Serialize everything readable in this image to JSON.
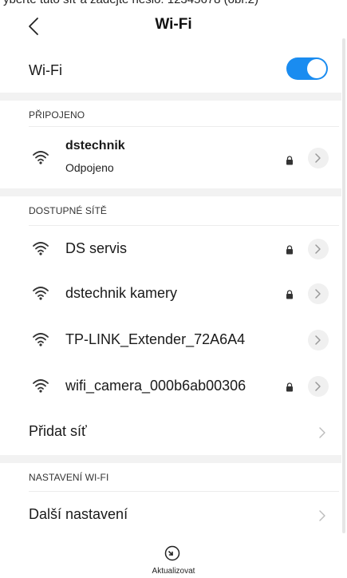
{
  "caption": "yberte tuto síť a zadejte heslo: 12345678 (obr.2)",
  "header": {
    "title": "Wi-Fi",
    "back_icon": "chevron-left-icon"
  },
  "wifi_toggle": {
    "label": "Wi-Fi",
    "on": true,
    "accent": "#1a8cf0"
  },
  "connected": {
    "header": "PŘIPOJENO",
    "network": {
      "name": "dstechnik",
      "status": "Odpojeno",
      "secured": true
    }
  },
  "available": {
    "header": "DOSTUPNÉ SÍTĚ",
    "networks": [
      {
        "name": "DS servis",
        "secured": true
      },
      {
        "name": "dstechnik kamery",
        "secured": true
      },
      {
        "name": "TP-LINK_Extender_72A6A4",
        "secured": false
      },
      {
        "name": "wifi_camera_000b6ab00306",
        "secured": true
      }
    ],
    "add_network": "Přidat síť"
  },
  "settings": {
    "header": "NASTAVENÍ WI-FI",
    "more": "Další nastavení"
  },
  "footer": {
    "refresh_label": "Aktualizovat",
    "refresh_icon": "refresh-icon"
  }
}
